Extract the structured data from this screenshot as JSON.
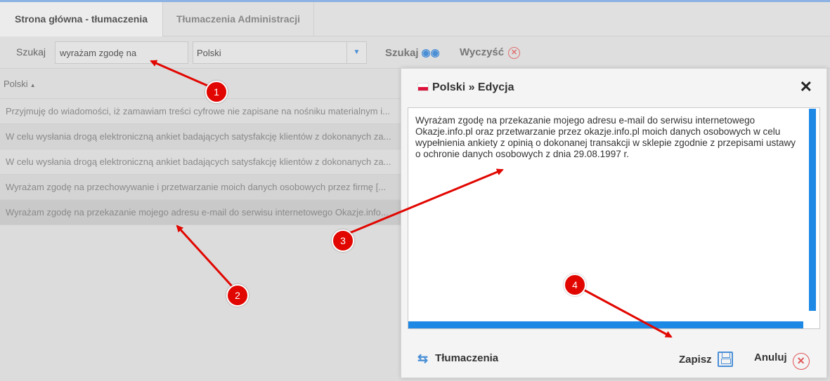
{
  "tabs": [
    {
      "label": "Strona główna - tłumaczenia"
    },
    {
      "label": "Tłumaczenia Administracji"
    }
  ],
  "search": {
    "label": "Szukaj",
    "value": "wyrażam zgodę na",
    "language": "Polski",
    "search_button": "Szukaj",
    "clear_button": "Wyczyść"
  },
  "table": {
    "header": "Polski",
    "rows": [
      "Przyjmuję do wiadomości, iż zamawiam treści cyfrowe nie zapisane na nośniku materialnym i...",
      "W celu wysłania drogą elektroniczną ankiet badających satysfakcję klientów z dokonanych za...",
      "W celu wysłania drogą elektroniczną ankiet badających satysfakcję klientów z dokonanych za...",
      "Wyrażam zgodę na przechowywanie i przetwarzanie moich danych osobowych przez firmę [...",
      "Wyrażam zgodę na przekazanie mojego adresu e-mail do serwisu internetowego Okazje.info..."
    ]
  },
  "modal": {
    "title": "Polski » Edycja",
    "close": "✕",
    "text": "Wyrażam zgodę na przekazanie mojego adresu e-mail do serwisu internetowego Okazje.info.pl oraz przetwarzanie przez okazje.info.pl moich danych osobowych w celu wypełnienia ankiety z opinią o dokonanej transakcji w sklepie zgodnie z przepisami ustawy o ochronie danych osobowych z dnia 29.08.1997 r.",
    "translate_button": "Tłumaczenia",
    "save_button": "Zapisz",
    "cancel_button": "Anuluj"
  },
  "annotations": [
    "1",
    "2",
    "3",
    "4"
  ],
  "colors": {
    "accent": "#1e88e5",
    "annotation": "#e10600",
    "cancel": "#e05555"
  }
}
